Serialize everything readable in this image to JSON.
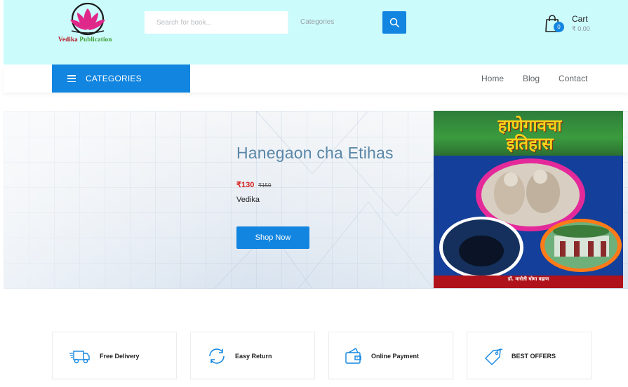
{
  "header": {
    "logo": {
      "text_main": "Vedika",
      "text_sub": "Publication",
      "brand_colors": [
        "#e0288a",
        "#b5121b",
        "#3a9a2c"
      ]
    },
    "search": {
      "placeholder": "Search for book...",
      "category_label": "Categories",
      "button_icon": "search-icon"
    },
    "cart": {
      "label": "Cart",
      "total": "₹ 0.00",
      "count": "0",
      "icon": "shopping-bag-icon"
    }
  },
  "nav": {
    "categories_label": "CATEGORIES",
    "links": [
      {
        "label": "Home"
      },
      {
        "label": "Blog"
      },
      {
        "label": "Contact"
      }
    ]
  },
  "hero": {
    "title": "Hanegaon cha Etihas",
    "price_now": "₹130",
    "price_old": "₹150",
    "author": "Vedika",
    "button": "Shop Now",
    "book_cover": {
      "title_line_1": "हाणेगावचा",
      "title_line_2": "इतिहास",
      "author": "डॉ. मारोती घोमा वहाण"
    }
  },
  "features": [
    {
      "label": "Free Delivery",
      "icon": "truck-icon"
    },
    {
      "label": "Easy Return",
      "icon": "refresh-icon"
    },
    {
      "label": "Online Payment",
      "icon": "wallet-icon"
    },
    {
      "label": "BEST OFFERS",
      "icon": "tag-icon"
    }
  ],
  "colors": {
    "accent": "#1185e0",
    "header_bg": "#ccfbfc",
    "price_red": "#d4201b",
    "title_blue": "#5a87a8"
  }
}
